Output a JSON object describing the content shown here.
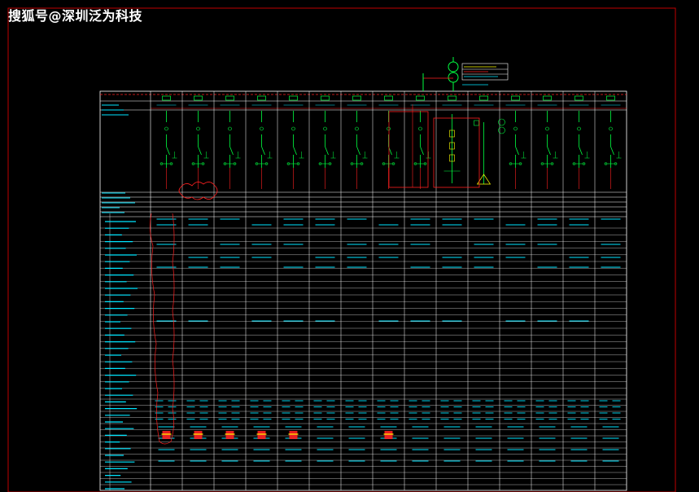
{
  "watermark": {
    "text": "搜狐号@深圳泛为科技"
  },
  "colors": {
    "background": "#000000",
    "sheet_border": "#c00000",
    "grid": "#ffffff",
    "cyan": "#00e5ff",
    "green": "#00ff40",
    "yellow": "#ffff00",
    "red": "#ff2020"
  },
  "diagram": {
    "panel_count": 15,
    "icons": [
      "transformer-icon",
      "breaker-icon",
      "disconnector-icon",
      "ct-icon",
      "ground-icon",
      "meter-icon"
    ]
  }
}
